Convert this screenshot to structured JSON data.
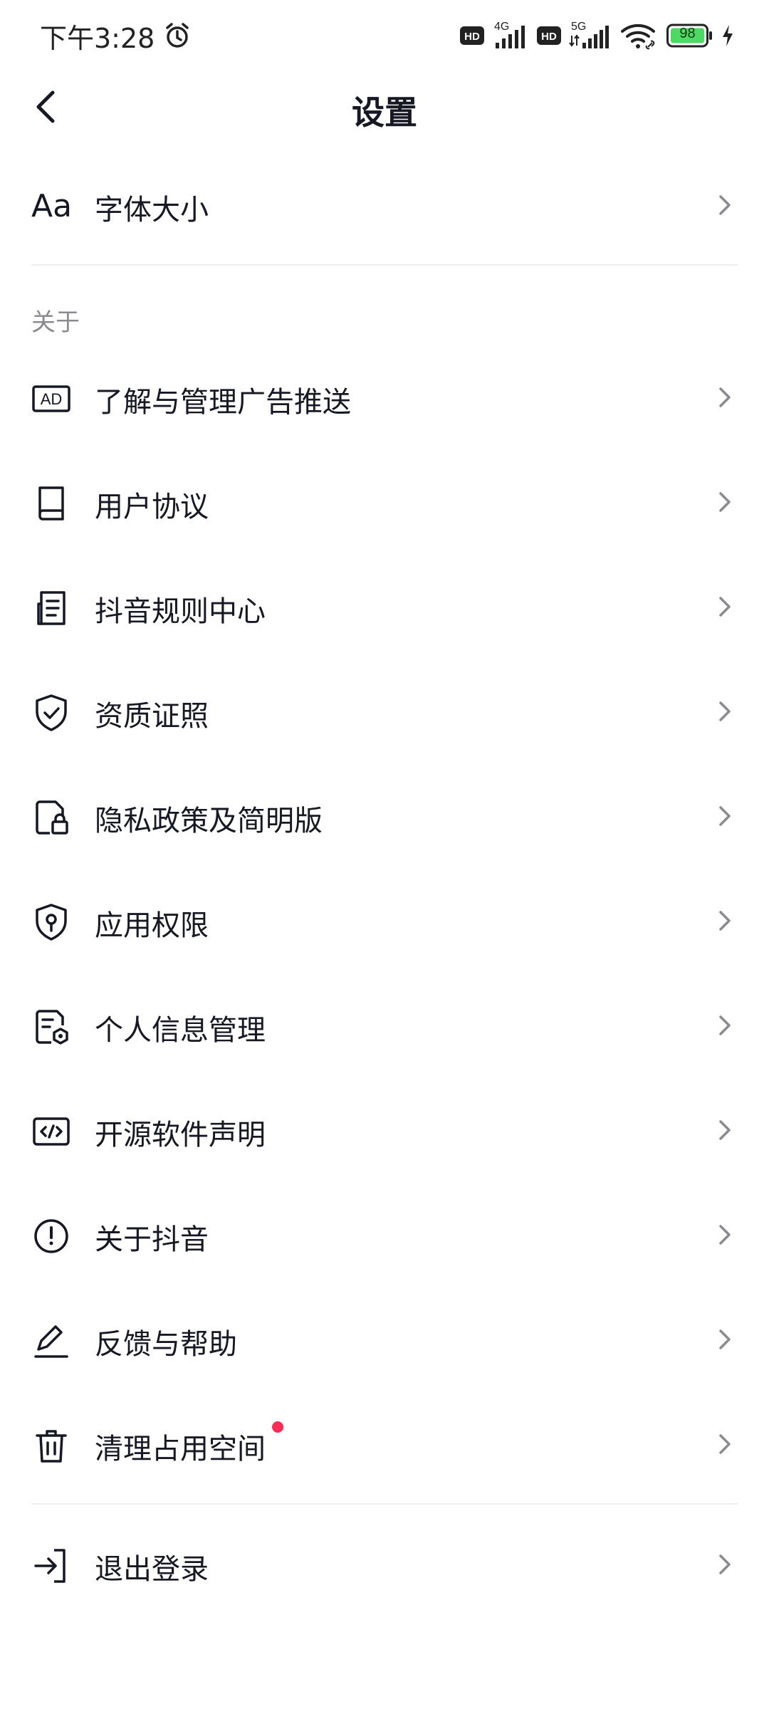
{
  "status_bar": {
    "time": "下午3:28",
    "net1_label": "4G",
    "net2_label": "5G",
    "hd_label": "HD",
    "battery": "98",
    "battery_color": "#4cd964"
  },
  "nav": {
    "title": "设置"
  },
  "font_size_row": {
    "icon_text": "Aa",
    "label": "字体大小"
  },
  "section_about": {
    "title": "关于"
  },
  "menu": [
    {
      "icon": "ad-icon",
      "label": "了解与管理广告推送"
    },
    {
      "icon": "book-icon",
      "label": "用户协议"
    },
    {
      "icon": "document-list-icon",
      "label": "抖音规则中心"
    },
    {
      "icon": "shield-check-icon",
      "label": "资质证照"
    },
    {
      "icon": "privacy-lock-icon",
      "label": "隐私政策及简明版"
    },
    {
      "icon": "permission-shield-icon",
      "label": "应用权限"
    },
    {
      "icon": "personal-info-icon",
      "label": "个人信息管理"
    },
    {
      "icon": "code-icon",
      "label": "开源软件声明"
    },
    {
      "icon": "info-circle-icon",
      "label": "关于抖音"
    },
    {
      "icon": "pen-icon",
      "label": "反馈与帮助"
    },
    {
      "icon": "trash-icon",
      "label": "清理占用空间",
      "badge_color": "#fe2c55"
    }
  ],
  "logout": {
    "icon": "logout-icon",
    "label": "退出登录"
  }
}
